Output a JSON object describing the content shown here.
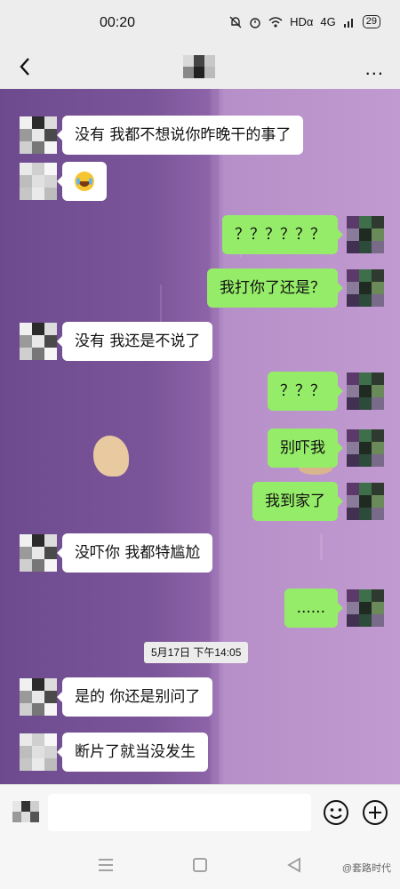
{
  "status_bar": {
    "time": "00:20",
    "network": "HDα",
    "signal": "4G",
    "battery": "29"
  },
  "nav": {
    "back_icon": "chevron-left-icon",
    "title_mosaic_colors": [
      "#d9d9d9",
      "#444",
      "#c8c8c8",
      "#888",
      "#222",
      "#bbb"
    ],
    "more_label": "..."
  },
  "timestamp": "5月17日 下午14:05",
  "messages": [
    {
      "side": "left",
      "text": "没有 我都不想说你昨晚干的事了"
    },
    {
      "side": "left",
      "text": "",
      "emoji": "laughing-crying-face-icon"
    },
    {
      "side": "right",
      "text": "？？？？？？"
    },
    {
      "side": "right",
      "text": "我打你了还是？"
    },
    {
      "side": "left",
      "text": "没有 我还是不说了"
    },
    {
      "side": "right",
      "text": "？？？"
    },
    {
      "side": "right",
      "text": "别吓我"
    },
    {
      "side": "right",
      "text": "我到家了"
    },
    {
      "side": "left",
      "text": "没吓你 我都特尴尬"
    },
    {
      "side": "right",
      "text": "......"
    },
    {
      "side": "left",
      "text": "是的 你还是别问了"
    },
    {
      "side": "left",
      "text": "断片了就当没发生"
    }
  ],
  "input": {
    "value": "",
    "emoji_icon": "smiley-icon",
    "plus_icon": "plus-circle-icon"
  },
  "system_nav": {
    "menu_icon": "menu-icon",
    "home_icon": "home-square-icon",
    "back_icon": "back-triangle-icon",
    "watermark": "@套路时代"
  },
  "colors": {
    "bubble_right": "#95ec69",
    "bubble_left": "#ffffff",
    "wallpaper": "#7b5599"
  }
}
